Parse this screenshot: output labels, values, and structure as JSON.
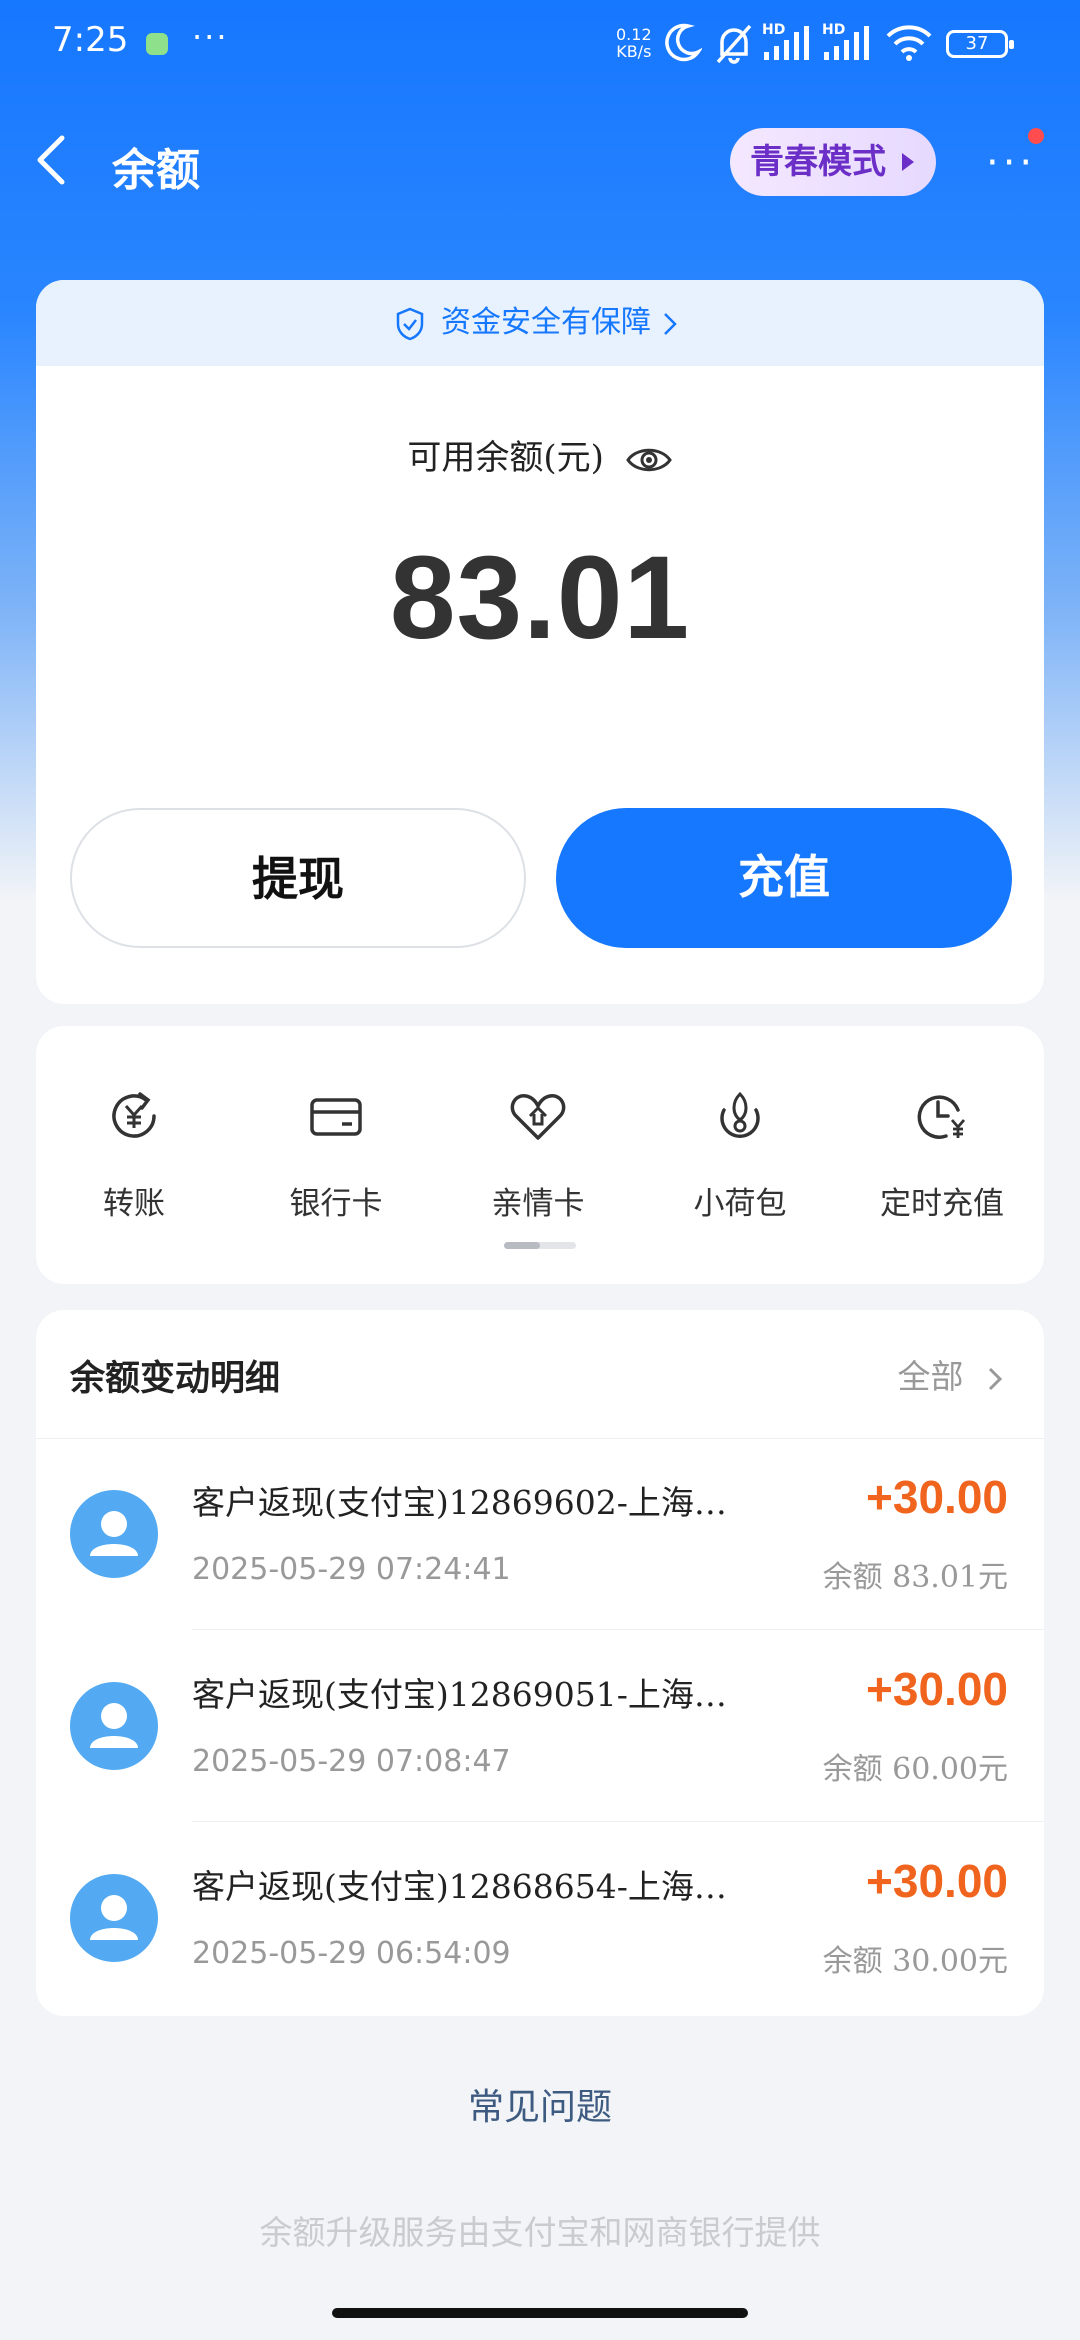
{
  "status_bar": {
    "time": "7:25",
    "more": "···",
    "net_speed_value": "0.12",
    "net_speed_unit": "KB/s",
    "signal1_label": "HD",
    "signal2_label": "HD",
    "battery": "37"
  },
  "nav": {
    "title": "余额",
    "youth_mode": "青春模式",
    "more": "···"
  },
  "balance": {
    "safety_banner": "资金安全有保障",
    "label": "可用余额(元)",
    "value": "83.01",
    "withdraw_label": "提现",
    "recharge_label": "充值"
  },
  "functions": [
    {
      "label": "转账",
      "icon": "transfer-icon"
    },
    {
      "label": "银行卡",
      "icon": "bank-card-icon"
    },
    {
      "label": "亲情卡",
      "icon": "family-card-icon"
    },
    {
      "label": "小荷包",
      "icon": "pouch-icon"
    },
    {
      "label": "定时充值",
      "icon": "scheduled-recharge-icon"
    }
  ],
  "transactions": {
    "title": "余额变动明细",
    "all_label": "全部",
    "items": [
      {
        "name": "客户返现(支付宝)12869602-上海…",
        "time": "2025-05-29 07:24:41",
        "amount": "+30.00",
        "remaining": "余额 83.01元"
      },
      {
        "name": "客户返现(支付宝)12869051-上海…",
        "time": "2025-05-29 07:08:47",
        "amount": "+30.00",
        "remaining": "余额 60.00元"
      },
      {
        "name": "客户返现(支付宝)12868654-上海…",
        "time": "2025-05-29 06:54:09",
        "amount": "+30.00",
        "remaining": "余额 30.00元"
      }
    ]
  },
  "faq_label": "常见问题",
  "footer_text": "余额升级服务由支付宝和网商银行提供",
  "colors": {
    "primary": "#1677ff",
    "amount_positive": "#f0641e",
    "youth_text": "#6b2fc7"
  }
}
